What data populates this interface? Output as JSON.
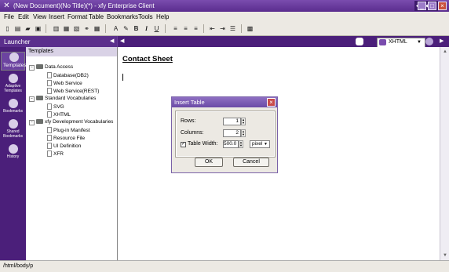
{
  "window": {
    "title": "(New Document)(No Title)(*) - xfy Enterprise Client",
    "minimize": "_",
    "maximize": "□",
    "close": "×"
  },
  "menu": [
    "File",
    "Edit",
    "View",
    "Insert",
    "Format",
    "Table",
    "Bookmarks",
    "Tools",
    "Help"
  ],
  "launcher": {
    "title": "Launcher",
    "rail": [
      {
        "label": "Templates",
        "icon": "templates-icon"
      },
      {
        "label": "Adaptive Templates",
        "icon": "adaptive-templates-icon"
      },
      {
        "label": "Bookmarks",
        "icon": "bookmarks-icon"
      },
      {
        "label": "Shared Bookmarks",
        "icon": "shared-bookmarks-icon"
      },
      {
        "label": "History",
        "icon": "history-icon"
      }
    ],
    "panel_title": "Templates",
    "tree": [
      {
        "label": "Data Access",
        "type": "folder"
      },
      {
        "label": "Database(DB2)",
        "type": "doc"
      },
      {
        "label": "Web Service",
        "type": "doc"
      },
      {
        "label": "Web Service(REST)",
        "type": "doc"
      },
      {
        "label": "Standard Vocabularies",
        "type": "folder"
      },
      {
        "label": "SVG",
        "type": "doc"
      },
      {
        "label": "XHTML",
        "type": "doc"
      },
      {
        "label": "xfy Development Vocabularies",
        "type": "folder"
      },
      {
        "label": "Plug-in Manifest",
        "type": "doc"
      },
      {
        "label": "Resource File",
        "type": "doc"
      },
      {
        "label": "UI Definition",
        "type": "doc"
      },
      {
        "label": "XFR",
        "type": "doc"
      }
    ]
  },
  "editor": {
    "vocabulary": "XHTML",
    "document_heading": "Contact Sheet"
  },
  "status": {
    "path": "/html/body/p"
  },
  "dialog": {
    "title": "Insert Table",
    "rows_label": "Rows:",
    "rows_value": "1",
    "columns_label": "Columns:",
    "columns_value": "2",
    "width_label": "Table Width:",
    "width_checked": true,
    "width_value": "500.0",
    "unit": "pixel",
    "ok": "OK",
    "cancel": "Cancel"
  }
}
